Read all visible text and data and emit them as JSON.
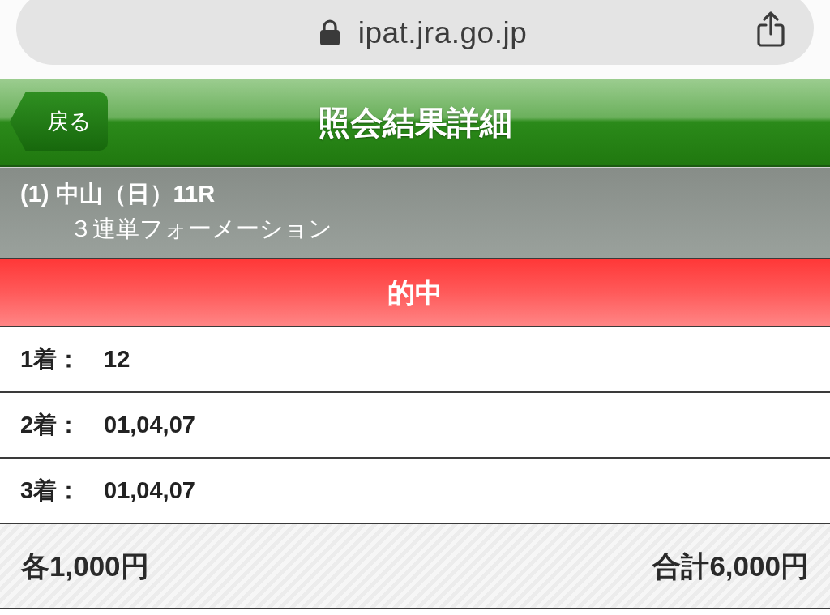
{
  "browser_bar": {
    "url": "ipat.jra.go.jp"
  },
  "header": {
    "back_button": "戻る",
    "title": "照会結果詳細"
  },
  "bet": {
    "race": "(1) 中山（日）11R",
    "bet_type": "３連単フォーメーション"
  },
  "result": {
    "label": "的中",
    "hit": true
  },
  "positions": [
    {
      "label": "1着：",
      "horses": "12"
    },
    {
      "label": "2着：",
      "horses": "01,04,07"
    },
    {
      "label": "3着：",
      "horses": "01,04,07"
    }
  ],
  "footer": {
    "unit_stake": "各1,000円",
    "total": "合計6,000円"
  }
}
